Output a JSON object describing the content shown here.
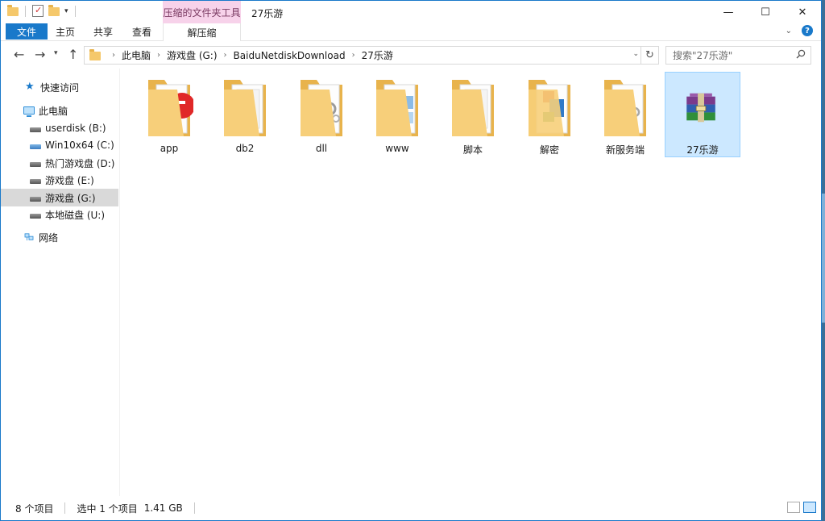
{
  "window": {
    "title": "27乐游",
    "context_tab_group": "压缩的文件夹工具",
    "controls": {
      "minimize": "—",
      "maximize": "☐",
      "close": "✕"
    }
  },
  "ribbon": {
    "tabs": [
      {
        "label": "文件"
      },
      {
        "label": "主页"
      },
      {
        "label": "共享"
      },
      {
        "label": "查看"
      },
      {
        "label": "解压缩"
      }
    ],
    "help": "?"
  },
  "address": {
    "crumbs": [
      "此电脑",
      "游戏盘 (G:)",
      "BaiduNetdiskDownload",
      "27乐游"
    ]
  },
  "search": {
    "placeholder": "搜索\"27乐游\""
  },
  "nav": {
    "items": [
      {
        "label": "快速访问",
        "icon": "star-icon"
      },
      {
        "label": "此电脑",
        "icon": "computer-icon"
      },
      {
        "label": "userdisk (B:)",
        "icon": "drive-icon"
      },
      {
        "label": "Win10x64 (C:)",
        "icon": "system-drive-icon"
      },
      {
        "label": "热门游戏盘 (D:)",
        "icon": "drive-icon"
      },
      {
        "label": "游戏盘 (E:)",
        "icon": "drive-icon"
      },
      {
        "label": "游戏盘 (G:)",
        "icon": "drive-icon",
        "selected": true
      },
      {
        "label": "本地磁盘 (U:)",
        "icon": "drive-icon"
      },
      {
        "label": "网络",
        "icon": "network-icon"
      }
    ]
  },
  "files": [
    {
      "label": "app",
      "type": "folder"
    },
    {
      "label": "db2",
      "type": "folder"
    },
    {
      "label": "dll",
      "type": "folder"
    },
    {
      "label": "www",
      "type": "folder"
    },
    {
      "label": "脚本",
      "type": "folder"
    },
    {
      "label": "解密",
      "type": "folder"
    },
    {
      "label": "新服务端",
      "type": "folder"
    },
    {
      "label": "27乐游",
      "type": "rar-archive",
      "selected": true
    }
  ],
  "status": {
    "count": "8 个项目",
    "selection": "选中 1 个项目",
    "size": "1.41 GB"
  },
  "colors": {
    "accent": "#1979ca",
    "selection": "#cce8ff",
    "folder": "#f5c86b",
    "context_tab": "#f7d2ea"
  }
}
